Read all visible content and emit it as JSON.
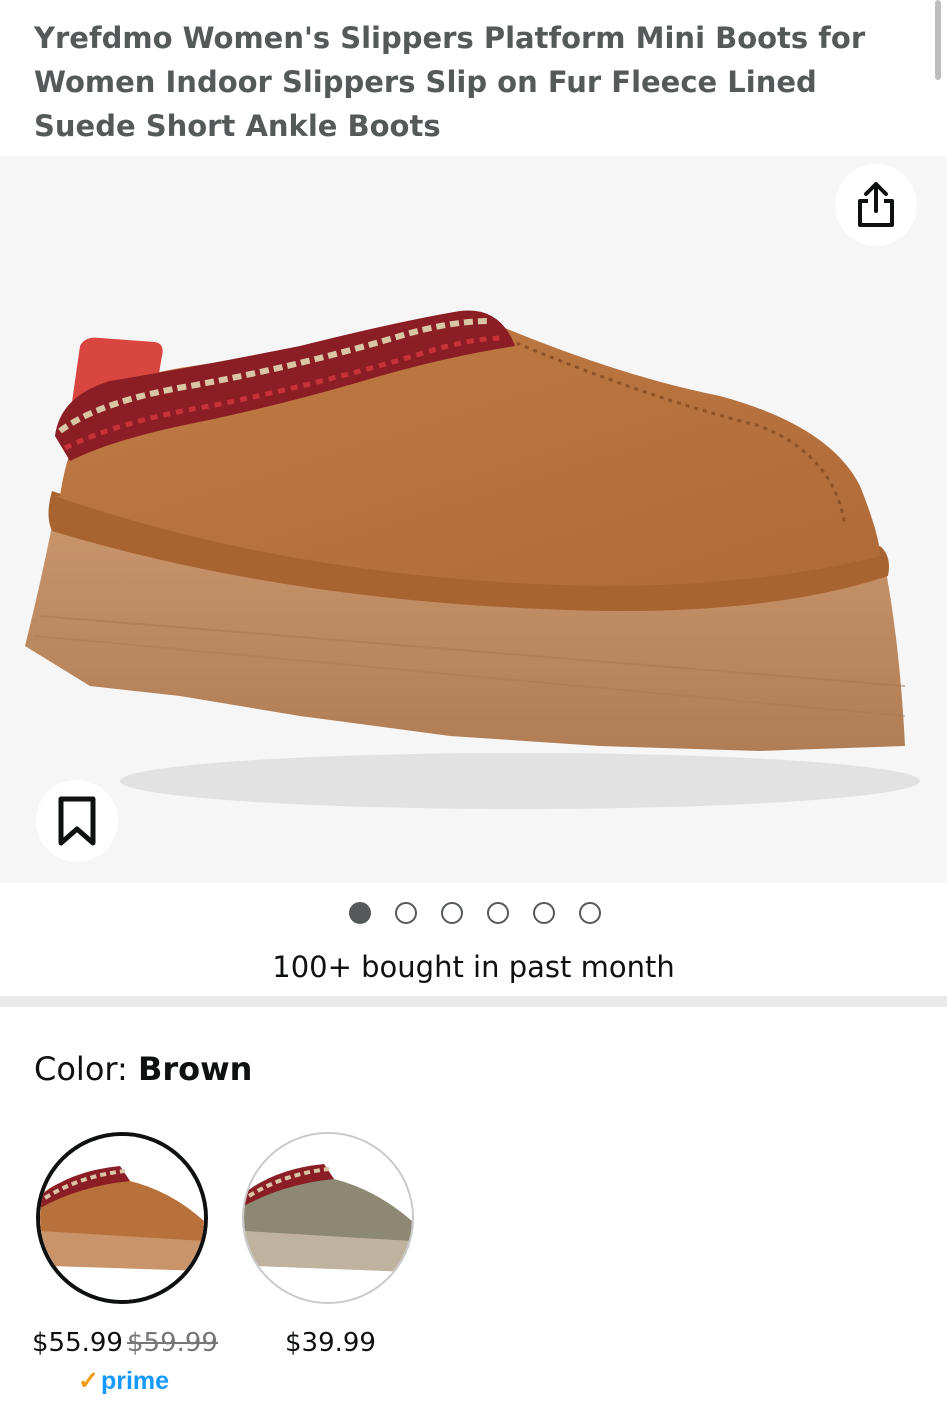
{
  "product": {
    "title": "Yrefdmo Women's Slippers Platform Mini Boots for Women Indoor Slippers Slip on Fur Fleece Lined Suede Short Ankle Boots"
  },
  "gallery": {
    "image_count": 6,
    "active_index": 0,
    "share_icon": "share-icon",
    "save_icon": "bookmark-icon"
  },
  "social_proof": "100+ bought in past month",
  "color": {
    "label": "Color: ",
    "selected": "Brown",
    "options": [
      {
        "price": "$55.99",
        "list_price": "$59.99",
        "badge": "prime",
        "selected": true
      },
      {
        "price": "$39.99",
        "selected": false
      }
    ]
  },
  "colors": {
    "brand_prime": "#1399ff",
    "prime_check": "#f39c12",
    "text_primary": "#0f1111",
    "text_secondary": "#565959"
  }
}
